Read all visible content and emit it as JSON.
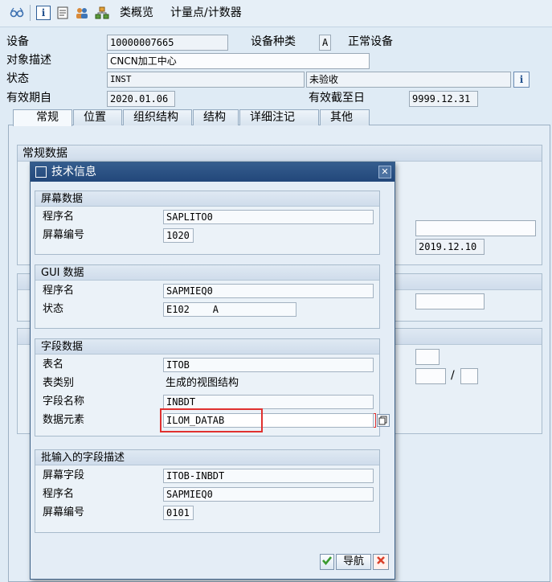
{
  "toolbar": {
    "icons": [
      "glasses-icon",
      "info-icon",
      "document-icon",
      "users-icon",
      "hierarchy-icon"
    ],
    "class_overview": "类概览",
    "measuring_points": "计量点/计数器"
  },
  "header": {
    "equipment_label": "设备",
    "equipment_value": "10000007665",
    "category_label": "设备种类",
    "category_value": "A",
    "category_text": "正常设备",
    "description_label": "对象描述",
    "description_value": "CNCN加工中心",
    "status_label": "状态",
    "status_value": "INST",
    "status_text": "未验收",
    "valid_from_label": "有效期自",
    "valid_from_value": "2020.01.06",
    "valid_to_label": "有效截至日",
    "valid_to_value": "9999.12.31"
  },
  "tabs": [
    {
      "label": "常规"
    },
    {
      "label": "位置"
    },
    {
      "label": "组织结构"
    },
    {
      "label": "结构"
    },
    {
      "label": "详细注记"
    },
    {
      "label": "其他"
    }
  ],
  "background_form": {
    "general_group_title": "常规数据",
    "date_value": "2019.12.10",
    "slash": "/"
  },
  "dialog": {
    "title": "技术信息",
    "screen_data": {
      "title": "屏幕数据",
      "program_label": "程序名",
      "program_value": "SAPLITO0",
      "screen_label": "屏幕编号",
      "screen_value": "1020"
    },
    "gui_data": {
      "title": "GUI 数据",
      "program_label": "程序名",
      "program_value": "SAPMIEQ0",
      "status_label": "状态",
      "status_value": "E102    A"
    },
    "field_data": {
      "title": "字段数据",
      "table_label": "表名",
      "table_value": "ITOB",
      "table_type_label": "表类别",
      "table_type_value": "生成的视图结构",
      "field_label": "字段名称",
      "field_value": "INBDT",
      "element_label": "数据元素",
      "element_value": "ILOM_DATAB"
    },
    "batch_input": {
      "title": "批输入的字段描述",
      "screen_field_label": "屏幕字段",
      "screen_field_value": "ITOB-INBDT",
      "program_label": "程序名",
      "program_value": "SAPMIEQ0",
      "screen_label": "屏幕编号",
      "screen_value": "0101"
    },
    "navigate_label": "导航"
  },
  "colors": {
    "title_bar": "#22477a",
    "highlight_box": "#e0312f",
    "ok_green": "#3a9a2e",
    "cancel_red": "#d9402b"
  }
}
